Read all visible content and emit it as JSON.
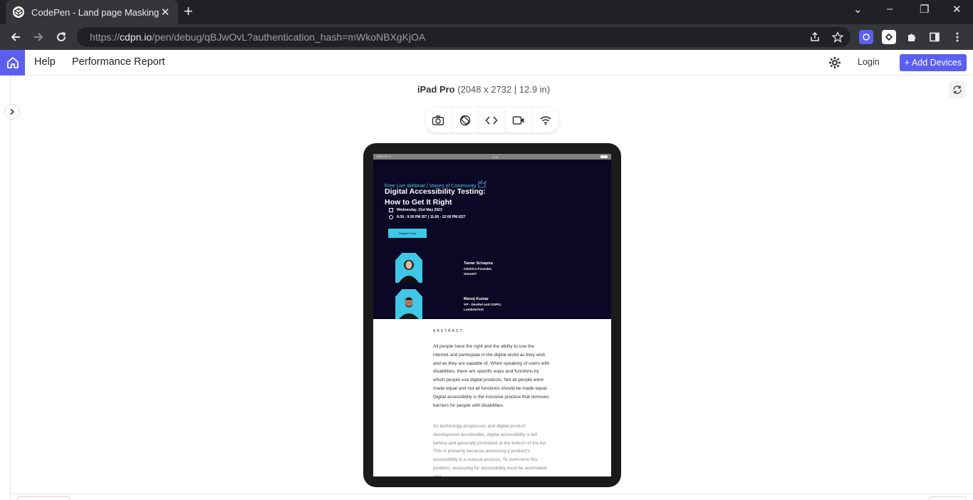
{
  "browser": {
    "tab_title": "CodePen - Land page Masking",
    "url_prefix": "https://",
    "url_domain": "cdpn.io",
    "url_path": "/pen/debug/qBJwOvL?authentication_hash=mWkoNBXgKjOA"
  },
  "header": {
    "help_label": "Help",
    "performance_label": "Performance Report",
    "login_label": "Login",
    "add_devices_label": "+ Add Devices",
    "accent_color": "#5b5ff0"
  },
  "device": {
    "name": "iPad Pro",
    "spec": "(2048 x 2732 | 12.9 in)",
    "status_left": "iPad Pro ᯤ",
    "status_center": "9:41"
  },
  "webinar": {
    "eyebrow": "Free Live Webinar | Voices of Community",
    "title_line1": "Digital Accessibility Testing:",
    "title_line2": "How to Get It Right",
    "date": "Wednesday, 31st May 2023",
    "time": "8:30 - 9:30 PM IST | 11:00 - 12:00 PM EST",
    "register_label": "Register Now",
    "speakers": [
      {
        "name": "Tamar Schapira",
        "role_line1": "CEO/Co-Founder,",
        "role_line2": "SenseIT"
      },
      {
        "name": "Manoj Kumar",
        "role_line1": "VP - DevRel and OSPO,",
        "role_line2": "LambdaTest"
      }
    ],
    "abstract_heading": "ABSTRACT",
    "paragraph1": "All people have the right and the ability to use the internet and participate in the digital world as they wish and as they are capable of. When speaking of users with disabilities, there are specific ways and functions by which people use digital products. Not all people were made equal and not all functions should be made equal. Digital accessibility is the inclusive practice that removes barriers for people with disabilities.",
    "paragraph2": "As technology progresses and digital product development accelerates, digital accessibility is left behind and generally prioritized at the bottom of the list. This is primarily because assessing a product's accessibility is a manual process. To overcome this problem, assessing for accessibility must be automated and..."
  }
}
